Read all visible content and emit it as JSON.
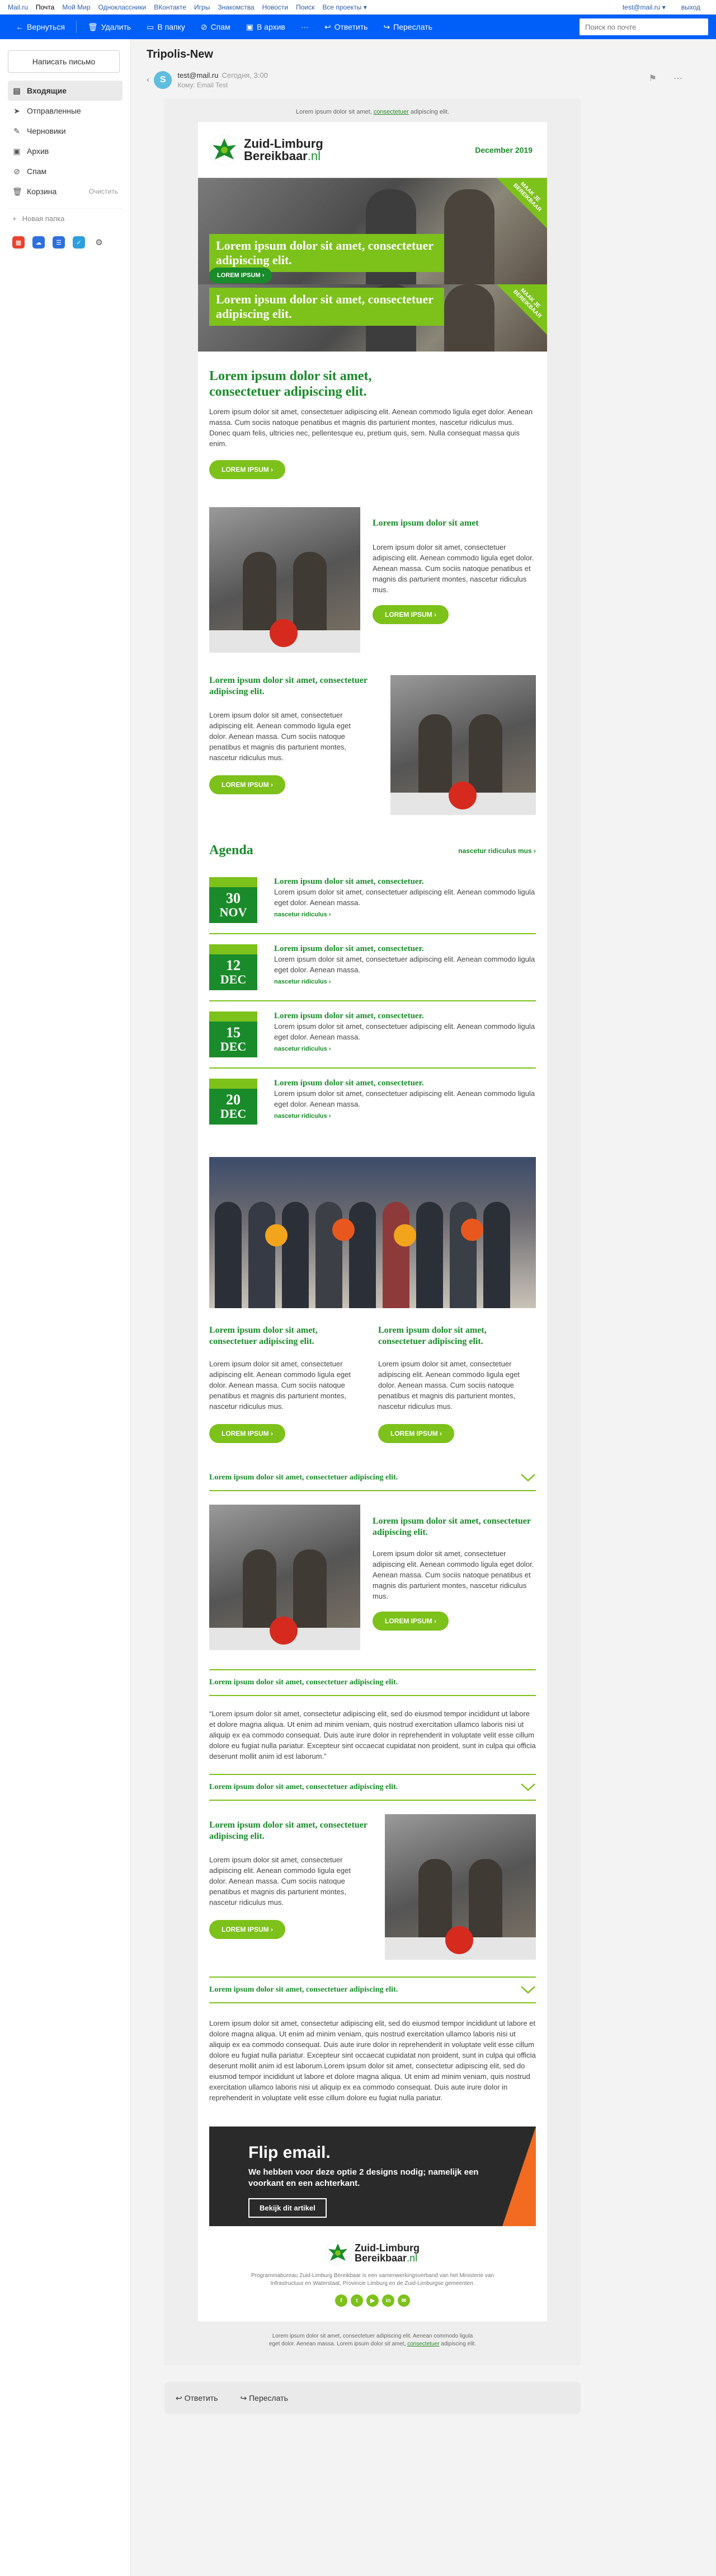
{
  "topnav": {
    "links": [
      "Mail.ru",
      "Почта",
      "Мой Мир",
      "Одноклассники",
      "ВКонтакте",
      "Игры",
      "Знакомства",
      "Новости",
      "Поиск",
      "Все проекты ▾"
    ],
    "user": "test@mail.ru ▾",
    "logout": "выход"
  },
  "toolbar": {
    "back": "Вернуться",
    "delete": "Удалить",
    "to_folder": "В папку",
    "spam": "Спам",
    "archive": "В архив",
    "more": "···",
    "reply": "Ответить",
    "forward": "Переслать",
    "search_placeholder": "Поиск по почте"
  },
  "sidebar": {
    "compose": "Написать письмо",
    "folders": [
      {
        "label": "Входящие",
        "icon": "inbox-icon",
        "active": true
      },
      {
        "label": "Отправленные",
        "icon": "sent-icon"
      },
      {
        "label": "Черновики",
        "icon": "drafts-icon"
      },
      {
        "label": "Архив",
        "icon": "archive-icon"
      },
      {
        "label": "Спам",
        "icon": "spam-icon"
      },
      {
        "label": "Корзина",
        "icon": "trash-icon",
        "extra": "Очистить"
      }
    ],
    "new_folder": "Новая папка"
  },
  "message": {
    "subject": "Tripolis-New",
    "avatar_letter": "S",
    "from": "test@mail.ru",
    "date": "Сегодня, 3:00",
    "to": "Кому: Email Test"
  },
  "newsletter": {
    "preheader": "Lorem ipsum dolor sit amet,",
    "preheader_link": "consectetuer",
    "preheader_tail": "adipiscing elit.",
    "brand_line1": "Zuid-Limburg",
    "brand_line2": "Bereikbaar",
    "brand_suffix": ".nl",
    "date": "December 2019",
    "hero": [
      {
        "title": "Lorem ipsum dolor sit amet, consectetuer adipiscing elit.",
        "button": "LOREM IPSUM  ›",
        "corner": "MAAK JE BEREIKBAAR"
      },
      {
        "title": "Lorem ipsum dolor sit amet, consectetuer adipiscing elit.",
        "corner": "MAAK JE BEREIKBAAR"
      }
    ],
    "intro": {
      "title": "Lorem ipsum dolor sit amet, consectetuer adipiscing elit.",
      "body": "Lorem ipsum dolor sit amet, consectetuer adipiscing elit. Aenean commodo ligula eget dolor. Aenean massa. Cum sociis natoque penatibus et magnis dis parturient montes, nascetur ridiculus mus. Donec quam felis, ultricies nec, pellentesque eu, pretium quis, sem. Nulla consequat massa quis enim.",
      "button": "LOREM IPSUM  ›"
    },
    "block1": {
      "title": "Lorem ipsum dolor sit amet",
      "body": "Lorem ipsum dolor sit amet, consectetuer adipiscing elit. Aenean commodo ligula eget dolor. Aenean massa. Cum sociis natoque penatibus et magnis dis parturient montes, nascetur ridiculus mus.",
      "button": "LOREM IPSUM  ›"
    },
    "block2": {
      "title": "Lorem ipsum dolor sit amet, consectetuer adipiscing elit.",
      "body": "Lorem ipsum dolor sit amet, consectetuer adipiscing elit. Aenean commodo ligula eget dolor. Aenean massa. Cum sociis natoque penatibus et magnis dis parturient montes, nascetur ridiculus mus.",
      "button": "LOREM IPSUM  ›"
    },
    "agenda": {
      "title": "Agenda",
      "more": "nascetur ridiculus mus ›",
      "items": [
        {
          "day": "30",
          "month": "NOV",
          "title": "Lorem ipsum dolor sit amet, consectetuer.",
          "body": "Lorem ipsum dolor sit amet, consectetuer adipiscing elit. Aenean commodo ligula eget dolor. Aenean massa.",
          "more": "nascetur ridiculus ›"
        },
        {
          "day": "12",
          "month": "DEC",
          "title": "Lorem ipsum dolor sit amet, consectetuer.",
          "body": "Lorem ipsum dolor sit amet, consectetuer adipiscing elit. Aenean commodo ligula eget dolor. Aenean massa.",
          "more": "nascetur ridiculus ›"
        },
        {
          "day": "15",
          "month": "DEC",
          "title": "Lorem ipsum dolor sit amet, consectetuer.",
          "body": "Lorem ipsum dolor sit amet, consectetuer adipiscing elit. Aenean commodo ligula eget dolor. Aenean massa.",
          "more": "nascetur ridiculus ›"
        },
        {
          "day": "20",
          "month": "DEC",
          "title": "Lorem ipsum dolor sit amet, consectetuer.",
          "body": "Lorem ipsum dolor sit amet, consectetuer adipiscing elit. Aenean commodo ligula eget dolor. Aenean massa.",
          "more": "nascetur ridiculus ›"
        }
      ]
    },
    "cols": [
      {
        "title": "Lorem ipsum dolor sit amet, consectetuer adipiscing elit.",
        "body": "Lorem ipsum dolor sit amet, consectetuer adipiscing elit. Aenean commodo ligula eget dolor. Aenean massa. Cum sociis natoque penatibus et magnis dis parturient montes, nascetur ridiculus mus.",
        "button": "LOREM IPSUM  ›"
      },
      {
        "title": "Lorem ipsum dolor sit amet, consectetuer adipiscing elit.",
        "body": "Lorem ipsum dolor sit amet, consectetuer adipiscing elit. Aenean commodo ligula eget dolor. Aenean massa. Cum sociis natoque penatibus et magnis dis parturient montes, nascetur ridiculus mus.",
        "button": "LOREM IPSUM  ›"
      }
    ],
    "acc1": "Lorem ipsum dolor sit amet, consectetuer adipiscing elit.",
    "block3": {
      "title": "Lorem ipsum dolor sit amet, consectetuer adipiscing elit.",
      "body": "Lorem ipsum dolor sit amet, consectetuer adipiscing elit. Aenean commodo ligula eget dolor. Aenean massa. Cum sociis natoque penatibus et magnis dis parturient montes, nascetur ridiculus mus.",
      "button": "LOREM IPSUM  ›"
    },
    "acc2": "Lorem ipsum dolor sit amet, consectetuer adipiscing elit.",
    "quote": "“Lorem ipsum dolor sit amet, consectetur adipiscing elit, sed do eiusmod tempor incididunt ut labore et dolore magna aliqua. Ut enim ad minim veniam, quis nostrud exercitation ullamco laboris nisi ut aliquip ex ea commodo consequat. Duis aute irure dolor in reprehenderit in voluptate velit esse cillum dolore eu fugiat nulla pariatur. Excepteur sint occaecat cupidatat non proident, sunt in culpa qui officia deserunt mollit anim id est laborum.”",
    "acc3": "Lorem ipsum dolor sit amet, consectetuer adipiscing elit.",
    "block4": {
      "title": "Lorem ipsum dolor sit amet, consectetuer adipiscing elit.",
      "body": "Lorem ipsum dolor sit amet, consectetuer adipiscing elit. Aenean commodo ligula eget dolor. Aenean massa. Cum sociis natoque penatibus et magnis dis parturient montes, nascetur ridiculus mus.",
      "button": "LOREM IPSUM  ›"
    },
    "acc4": "Lorem ipsum dolor sit amet, consectetuer adipiscing elit.",
    "longtext": "Lorem ipsum dolor sit amet, consectetur adipiscing elit, sed do eiusmod tempor incididunt ut labore et dolore magna aliqua. Ut enim ad minim veniam, quis nostrud exercitation ullamco laboris nisi ut aliquip ex ea commodo consequat. Duis aute irure dolor in reprehenderit in voluptate velit esse cillum dolore eu fugiat nulla pariatur. Excepteur sint occaecat cupidatat non proident, sunt in culpa qui officia deserunt mollit anim id est laborum.Lorem ipsum dolor sit amet, consectetur adipiscing elit, sed do eiusmod tempor incididunt ut labore et dolore magna aliqua. Ut enim ad minim veniam, quis nostrud exercitation ullamco laboris nisi ut aliquip ex ea commodo consequat. Duis aute irure dolor in reprehenderit in voluptate velit esse cillum dolore eu fugiat nulla pariatur.",
    "flip": {
      "title": "Flip email.",
      "body": "We hebben voor deze optie 2 designs nodig; namelijk een voorkant en een achterkant.",
      "button": "Bekijk dit artikel"
    },
    "disclaimer": "Programmabureau Zuid-Limburg Bereikbaar is een samenwerkingsverband van het Ministerie van Infrastructuur en Waterstaat, Provincie Limburg en de Zuid-Limburgse gemeenten.",
    "social": [
      "f",
      "t",
      "▶",
      "in",
      "✉"
    ],
    "outer_footer": "Lorem ipsum dolor sit amet, consectetuer adipiscing elit. Aenean commodo ligula eget dolor. Aenean massa. Lorem ipsum dolor sit amet,",
    "outer_footer_link": "consectetuer",
    "outer_footer_tail": "adipiscing elit."
  },
  "replybar": {
    "reply": "Ответить",
    "forward": "Переслать"
  },
  "colors": {
    "brand_blue": "#005ff9",
    "green_dark": "#1a8b2a",
    "green_light": "#7dc11b",
    "flip_orange": "#f26b21"
  }
}
